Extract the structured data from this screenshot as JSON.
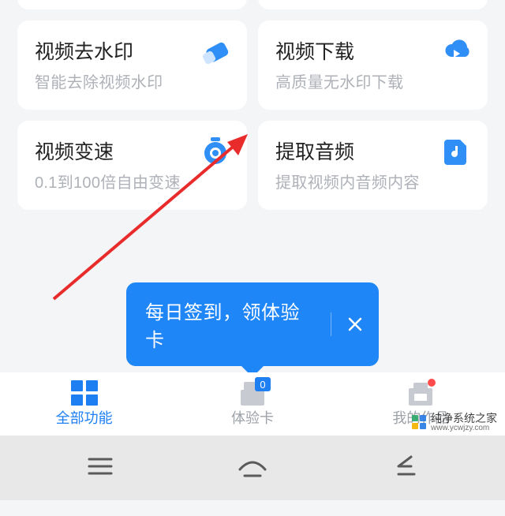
{
  "colors": {
    "accent": "#1e7ff2"
  },
  "tooltip": {
    "message": "每日签到，领体验卡"
  },
  "features": {
    "row1": [
      {
        "title": "视频去水印",
        "sub": "智能去除视频水印",
        "icon": "eraser-icon"
      },
      {
        "title": "视频下载",
        "sub": "高质量无水印下载",
        "icon": "cloud-download-icon"
      }
    ],
    "row2": [
      {
        "title": "视频变速",
        "sub": "0.1到100倍自由变速",
        "icon": "stopwatch-icon"
      },
      {
        "title": "提取音频",
        "sub": "提取视频内音频内容",
        "icon": "audio-file-icon"
      }
    ]
  },
  "tabbar": {
    "items": [
      {
        "label": "全部功能",
        "active": true
      },
      {
        "label": "体验卡",
        "badge": "0"
      },
      {
        "label": "我的作品"
      }
    ]
  },
  "watermark": {
    "main": "纯净系统之家",
    "url": "www.ycwjzy.com"
  }
}
